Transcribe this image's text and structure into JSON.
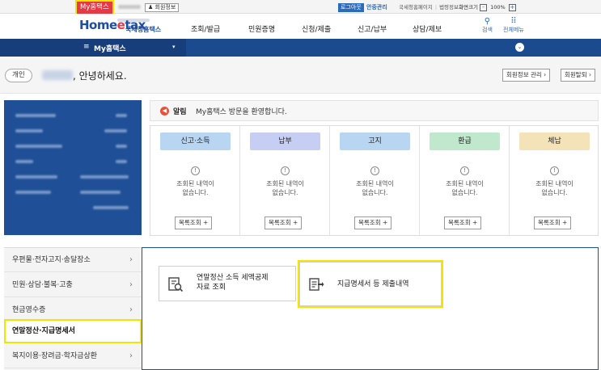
{
  "topbar": {
    "my_hometax_tag": "My홈택스",
    "member_info_btn": "회원정보",
    "logout_btn": "로그아웃",
    "center_link": "안중관리",
    "util_links": [
      "국세청홈페이지",
      "법령정보"
    ],
    "font_size_label": "화면크기",
    "zoom_out": "-",
    "zoom_value": "100%",
    "zoom_in": "+"
  },
  "header": {
    "logo": {
      "home": "Home",
      "e": "e",
      "tax": "tax",
      "sub": "국세청홈택스"
    },
    "gnb": [
      "조회/발급",
      "민원증명",
      "신청/제출",
      "신고/납부",
      "상담/제보"
    ],
    "search_label": "검색",
    "all_menu_label": "전체메뉴"
  },
  "navbar": {
    "title": "My홈택스",
    "hamburger": "≡",
    "caret": "▾",
    "right_toggle": "⌄"
  },
  "greeting": {
    "badge": "개인",
    "text": ", 안녕하세요.",
    "member_info_btn": "회원정보 관리 ›",
    "withdraw_btn": "회원탈퇴 ›"
  },
  "alert": {
    "icon": "megaphone-icon",
    "label": "알림",
    "message": "My홈택스 방문을 환영합니다."
  },
  "cards": [
    {
      "title": "신고·소득",
      "color": "#b8d6f2",
      "info": "!",
      "empty_line1": "조회된 내역이",
      "empty_line2": "없습니다.",
      "button": "목록조회 +"
    },
    {
      "title": "납부",
      "color": "#c6cff3",
      "info": "!",
      "empty_line1": "조회된 내역이",
      "empty_line2": "없습니다.",
      "button": "목록조회 +"
    },
    {
      "title": "고지",
      "color": "#b8d6f2",
      "info": "!",
      "empty_line1": "조회된 내역이",
      "empty_line2": "없습니다.",
      "button": "목록조회 +"
    },
    {
      "title": "환급",
      "color": "#bfe8cc",
      "info": "!",
      "empty_line1": "조회된 내역이",
      "empty_line2": "없습니다.",
      "button": "목록조회 +"
    },
    {
      "title": "체납",
      "color": "#f4e2b8",
      "info": "!",
      "empty_line1": "조회된 내역이",
      "empty_line2": "없습니다.",
      "button": "목록조회 +"
    }
  ],
  "sidebar": {
    "items": [
      {
        "label": "우편물·전자고지·송달장소",
        "chevron": "›"
      },
      {
        "label": "민원·상담·불복·고충",
        "chevron": "›"
      },
      {
        "label": "현금영수증",
        "chevron": "›"
      },
      {
        "label": "연말정산·지급명세서",
        "chevron": ""
      },
      {
        "label": "복지이용·장려금·학자금상환",
        "chevron": "›"
      }
    ]
  },
  "services": [
    {
      "label_line1": "연말정산 소득 세액공제",
      "label_line2": "자료 조회",
      "icon": "document-search-icon"
    },
    {
      "label_line1": "지급명세서 등 제출내역",
      "label_line2": "",
      "icon": "document-submit-icon"
    }
  ],
  "colors": {
    "accent_blue": "#1c4a8e",
    "highlight_yellow": "#f2e600",
    "brand_red": "#e53945"
  }
}
